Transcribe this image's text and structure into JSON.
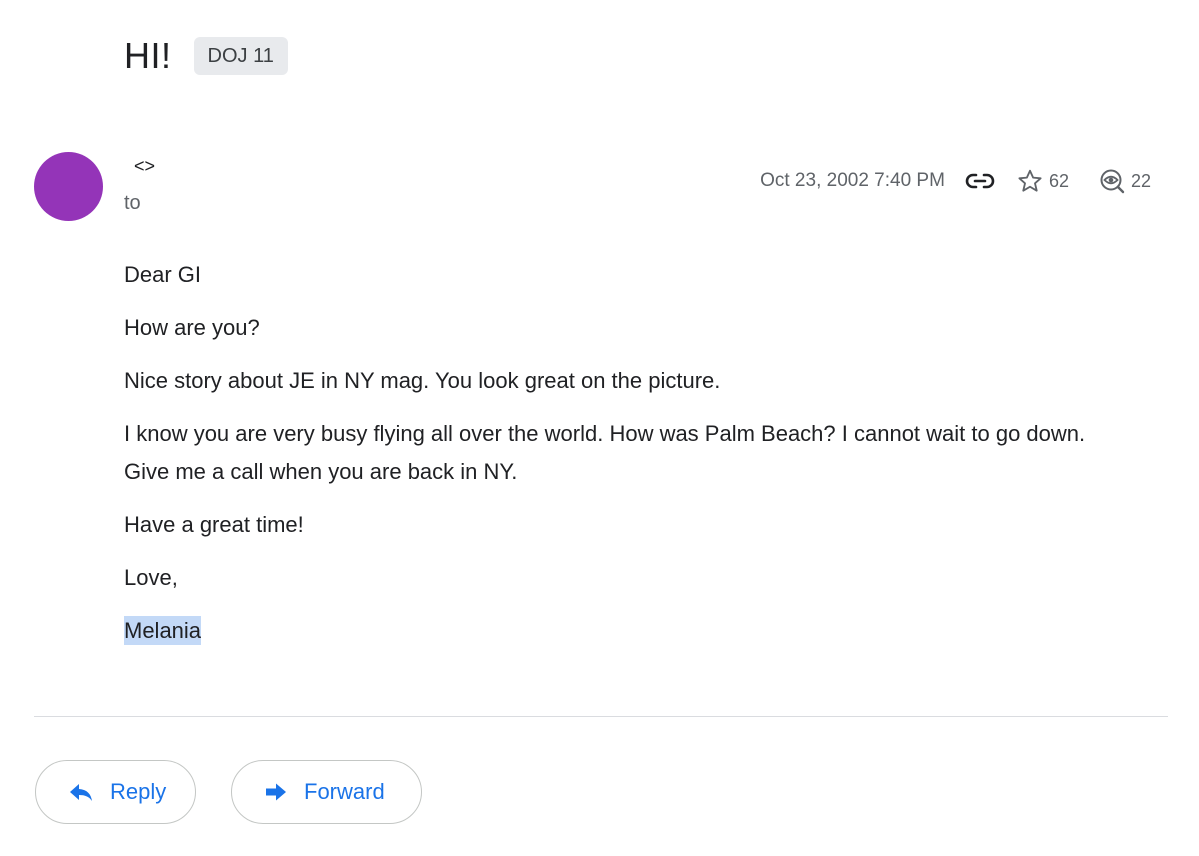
{
  "email": {
    "subject": "HI!",
    "label": "DOJ 11",
    "sender": "<>",
    "to_label": "to",
    "date": "Oct 23, 2002 7:40 PM",
    "star_count": "62",
    "view_count": "22",
    "body": {
      "lines": [
        "Dear GI",
        "How are you?",
        "Nice story about JE in NY mag. You look great on the picture.",
        "I know you are very busy flying all over the world. How was Palm Beach? I cannot wait to go down. Give me a call when you are back in NY.",
        "Have a great time!",
        "Love,"
      ],
      "signature": "Melania"
    }
  },
  "actions": {
    "reply_label": "Reply",
    "forward_label": "Forward"
  },
  "colors": {
    "avatar": "#9434b8",
    "accent": "#1a73e8",
    "selection": "#c3d9f7"
  },
  "icons": {
    "link": "link-icon",
    "star": "star-icon",
    "views": "views-icon",
    "reply": "reply-arrow-icon",
    "forward": "forward-arrow-icon"
  }
}
